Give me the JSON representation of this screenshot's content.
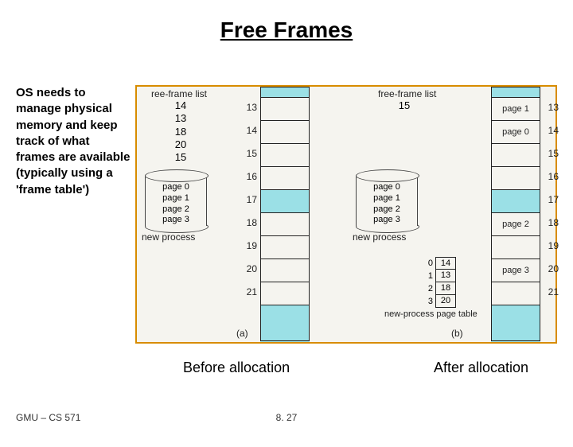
{
  "title": "Free Frames",
  "body_text": "OS needs to manage physical memory and keep track of what frames are available (typically using a 'frame table')",
  "before": {
    "free_frame_label": "ree-frame list",
    "free_frames": [
      "14",
      "13",
      "18",
      "20",
      "15"
    ],
    "cylinder_pages": [
      "page 0",
      "page 1",
      "page 2",
      "page 3"
    ],
    "new_process_label": "new process",
    "frame_numbers": [
      "13",
      "14",
      "15",
      "16",
      "17",
      "18",
      "19",
      "20",
      "21"
    ],
    "sub": "(a)",
    "caption": "Before allocation"
  },
  "after": {
    "free_frame_label": "free-frame list",
    "free_frames": [
      "15"
    ],
    "cylinder_pages": [
      "page 0",
      "page 1",
      "page 2",
      "page 3"
    ],
    "new_process_label": "new process",
    "frame_numbers": [
      "13",
      "14",
      "15",
      "16",
      "17",
      "18",
      "19",
      "20",
      "21"
    ],
    "frame_contents": {
      "13": "page 1",
      "14": "page 0",
      "18": "page 2",
      "20": "page 3"
    },
    "page_table": [
      {
        "idx": "0",
        "frame": "14"
      },
      {
        "idx": "1",
        "frame": "13"
      },
      {
        "idx": "2",
        "frame": "18"
      },
      {
        "idx": "3",
        "frame": "20"
      }
    ],
    "page_table_caption": "new-process page table",
    "sub": "(b)",
    "caption": "After allocation"
  },
  "footer": {
    "left": "GMU – CS 571",
    "center": "8. 27"
  }
}
